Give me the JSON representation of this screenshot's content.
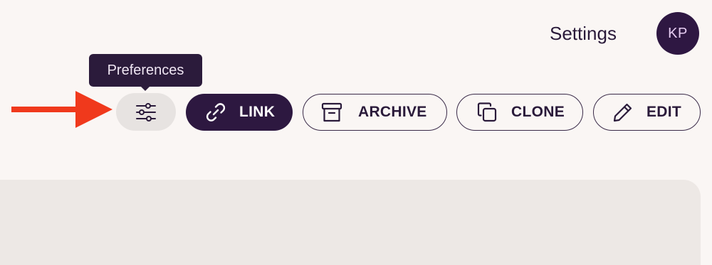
{
  "header": {
    "title": "Settings",
    "avatar_initials": "KP"
  },
  "tooltip": {
    "text": "Preferences"
  },
  "toolbar": {
    "preferences_icon": "sliders-icon",
    "buttons": [
      {
        "label": "LINK",
        "icon": "link-icon",
        "style": "filled"
      },
      {
        "label": "ARCHIVE",
        "icon": "archive-icon",
        "style": "outline"
      },
      {
        "label": "CLONE",
        "icon": "copy-icon",
        "style": "outline"
      },
      {
        "label": "EDIT",
        "icon": "pencil-icon",
        "style": "outline"
      }
    ]
  },
  "annotation": {
    "arrow_color": "#f0391c",
    "points_to": "preferences-button"
  },
  "colors": {
    "background": "#faf6f4",
    "primary": "#2d1840",
    "avatar_text": "#e6ccf2",
    "panel": "#ede8e5"
  }
}
